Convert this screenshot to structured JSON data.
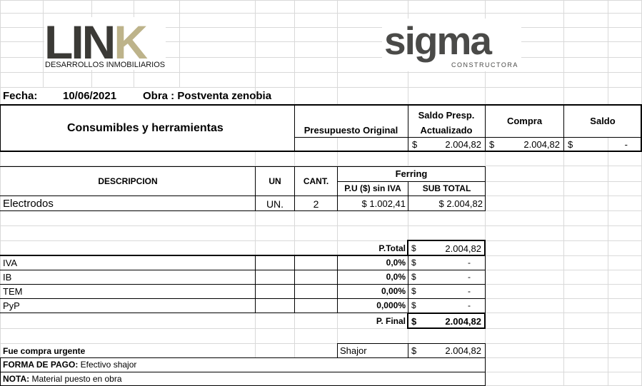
{
  "logos": {
    "link_word": "LINK",
    "link_sub": "DESARROLLOS INMOBILIARIOS",
    "sigma_word": "sigma",
    "sigma_sub": "CONSTRUCTORA"
  },
  "header": {
    "fecha_label": "Fecha:",
    "fecha_value": "10/06/2021",
    "obra": "Obra : Postventa zenobia"
  },
  "budget": {
    "title": "Consumibles y herramientas",
    "presupuesto_label": "Presupuesto Original",
    "saldo_presp_line1": "Saldo Presp.",
    "saldo_presp_line2": "Actualizado",
    "compra_label": "Compra",
    "saldo_label": "Saldo",
    "currency": "$",
    "saldo_presp_value": "2.004,82",
    "compra_value": "2.004,82",
    "saldo_value": "-"
  },
  "items_table": {
    "col_descripcion": "DESCRIPCION",
    "col_un": "UN",
    "col_cant": "CANT.",
    "supplier": "Ferring",
    "col_pu": "P.U ($) sin IVA",
    "col_subtotal": "SUB TOTAL",
    "rows": [
      {
        "descripcion": "Electrodos",
        "un": "UN.",
        "cant": "2",
        "pu": "$ 1.002,41",
        "subtotal": "$ 2.004,82"
      }
    ]
  },
  "totals": {
    "ptotal_label": "P.Total",
    "ptotal_value": "2.004,82",
    "taxes": [
      {
        "label": "IVA",
        "pct": "0,0%",
        "value": "-"
      },
      {
        "label": "IB",
        "pct": "0,0%",
        "value": "-"
      },
      {
        "label": "TEM",
        "pct": "0,00%",
        "value": "-"
      },
      {
        "label": "PyP",
        "pct": "0,000%",
        "value": "-"
      }
    ],
    "pfinal_label": "P. Final",
    "pfinal_value": "2.004,82"
  },
  "footer": {
    "urgente_label": "Fue compra urgente",
    "urgente_supplier": "Shajor",
    "urgente_value": "2.004,82",
    "forma_label": "FORMA DE PAGO:",
    "forma_value": "Efectivo shajor",
    "nota_label": "NOTA:",
    "nota_value": "Material puesto en obra"
  },
  "colors": {
    "link_dark": "#3b3a36",
    "link_gold": "#bdb38a",
    "sigma_gray": "#4a4a48",
    "gridline": "#d9d9d9"
  }
}
